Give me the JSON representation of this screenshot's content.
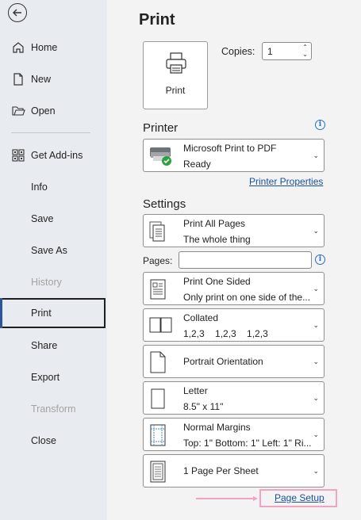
{
  "sidebar": {
    "items": [
      {
        "label": "Home",
        "icon": "home-icon"
      },
      {
        "label": "New",
        "icon": "new-document-icon"
      },
      {
        "label": "Open",
        "icon": "folder-open-icon"
      },
      {
        "label": "Get Add-ins",
        "icon": "grid-icon"
      },
      {
        "label": "Info"
      },
      {
        "label": "Save"
      },
      {
        "label": "Save As"
      },
      {
        "label": "History",
        "disabled": true
      },
      {
        "label": "Print",
        "active": true
      },
      {
        "label": "Share"
      },
      {
        "label": "Export"
      },
      {
        "label": "Transform",
        "disabled": true
      },
      {
        "label": "Close"
      }
    ]
  },
  "print": {
    "title": "Print",
    "button_label": "Print",
    "copies_label": "Copies:",
    "copies_value": "1"
  },
  "printer": {
    "heading": "Printer",
    "name": "Microsoft Print to PDF",
    "status": "Ready",
    "properties_link": "Printer Properties"
  },
  "settings": {
    "heading": "Settings",
    "pages_label": "Pages:",
    "pages_value": "",
    "range": {
      "line1": "Print All Pages",
      "line2": "The whole thing"
    },
    "sides": {
      "line1": "Print One Sided",
      "line2": "Only print on one side of the..."
    },
    "collation": {
      "line1": "Collated",
      "line2": "1,2,3    1,2,3    1,2,3"
    },
    "orientation": {
      "line1": "Portrait Orientation"
    },
    "paper": {
      "line1": "Letter",
      "line2": "8.5\" x 11\""
    },
    "margins": {
      "line1": "Normal Margins",
      "line2": "Top: 1\" Bottom: 1\" Left: 1\" Ri..."
    },
    "per_sheet": {
      "line1": "1 Page Per Sheet"
    },
    "page_setup_link": "Page Setup"
  },
  "colors": {
    "accent": "#2b579a",
    "link": "#1a4f9c",
    "annotation": "#f3a2c4"
  }
}
